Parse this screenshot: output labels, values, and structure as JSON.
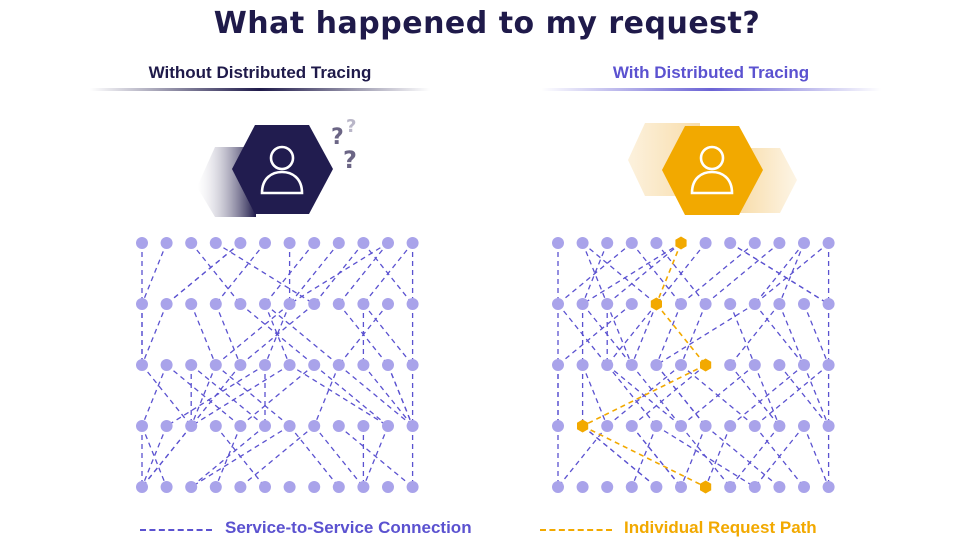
{
  "title": "What happened to my request?",
  "left": {
    "heading": "Without Distributed Tracing",
    "question_marks": "??"
  },
  "right": {
    "heading": "With Distributed Tracing"
  },
  "legend": {
    "service_connection": "Service-to-Service Connection",
    "request_path": "Individual Request Path"
  },
  "colors": {
    "dark_navy": "#1f1a4a",
    "purple": "#5b52d0",
    "node": "#a9a3ea",
    "orange": "#f2a900",
    "light_orange": "#f8ddab"
  },
  "icons": [
    "user-icon",
    "question-icon",
    "hexagon-icon"
  ]
}
